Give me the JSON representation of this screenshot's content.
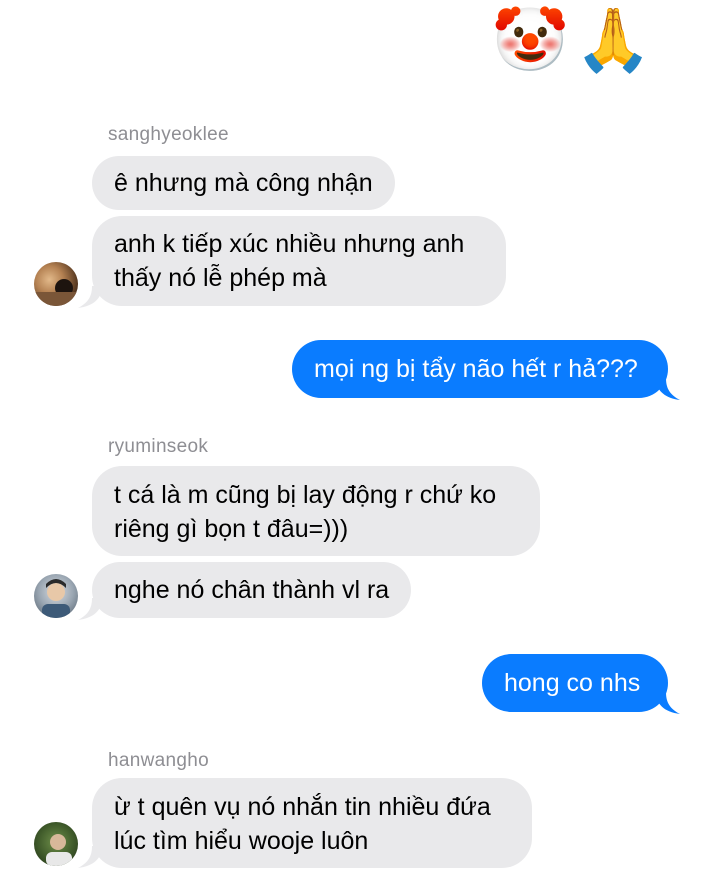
{
  "top_emojis": [
    "🤡",
    "🙏"
  ],
  "conversation": [
    {
      "sender": "sanghyeoklee",
      "messages": [
        "ê nhưng mà công nhận",
        "anh k tiếp xúc nhiều nhưng anh\nthấy nó lễ phép mà"
      ]
    },
    {
      "outgoing": "mọi ng bị tẩy não hết r hả???"
    },
    {
      "sender": "ryuminseok",
      "messages": [
        "t cá là m cũng bị lay động r chứ ko\nriêng gì bọn t đâu=)))",
        "nghe nó chân thành vl ra"
      ]
    },
    {
      "outgoing": "hong co nhs"
    },
    {
      "sender": "hanwangho",
      "messages": [
        "ừ t quên vụ nó nhắn tin nhiều đứa\nlúc tìm hiểu wooje luôn"
      ]
    }
  ],
  "colors": {
    "incoming_bubble": "#e9e9eb",
    "outgoing_bubble": "#0a7cff",
    "sender_name": "#8e8e93"
  }
}
